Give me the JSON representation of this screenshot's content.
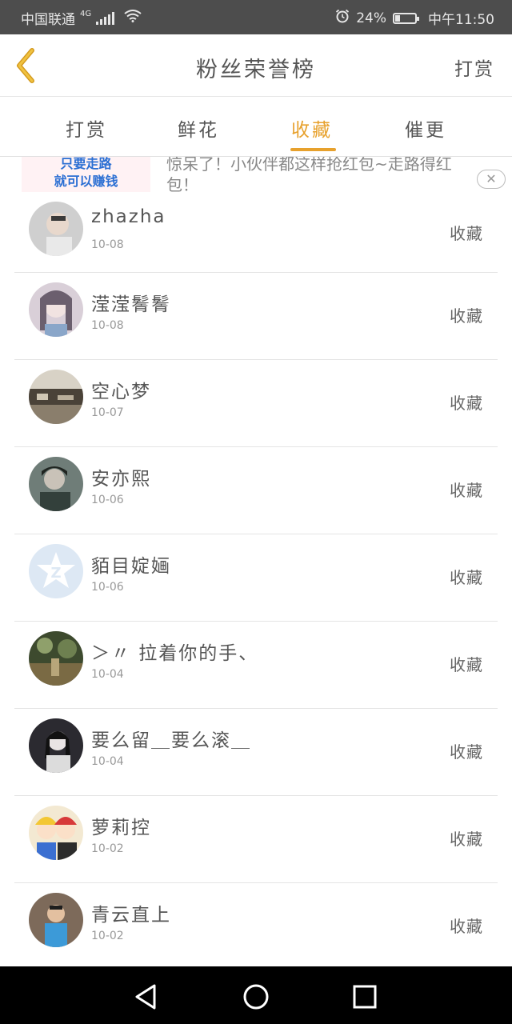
{
  "status_bar": {
    "carrier": "中国联通",
    "network": "4G",
    "battery": "24%",
    "battery_level": 0.24,
    "time": "中午11:50"
  },
  "header": {
    "title": "粉丝荣誉榜",
    "action_label": "打赏"
  },
  "tabs": [
    {
      "label": "打赏",
      "active": false
    },
    {
      "label": "鲜花",
      "active": false
    },
    {
      "label": "收藏",
      "active": true
    },
    {
      "label": "催更",
      "active": false
    }
  ],
  "ad": {
    "box_line1": "只要走路",
    "box_line2": "就可以赚钱",
    "text": "惊呆了！小伙伴都这样抢红包~走路得红包！",
    "close_label": "✕"
  },
  "fans": [
    {
      "name": "zhazha",
      "date": "10-08",
      "action": "收藏"
    },
    {
      "name": "滢滢鬌鬌",
      "date": "10-08",
      "action": "收藏"
    },
    {
      "name": "空心梦",
      "date": "10-07",
      "action": "收藏"
    },
    {
      "name": "安亦熙",
      "date": "10-06",
      "action": "收藏"
    },
    {
      "name": "貊目婝婳",
      "date": "10-06",
      "action": "收藏"
    },
    {
      "name": "＞〃 拉着你的手、",
      "date": "10-04",
      "action": "收藏"
    },
    {
      "name": "要么留＿要么滚＿",
      "date": "10-04",
      "action": "收藏"
    },
    {
      "name": "萝莉控",
      "date": "10-02",
      "action": "收藏"
    },
    {
      "name": "青云直上",
      "date": "10-02",
      "action": "收藏"
    }
  ],
  "colors": {
    "accent": "#e7a12d",
    "status_bar": "#4d4d4d",
    "nav_bar": "#000000"
  }
}
